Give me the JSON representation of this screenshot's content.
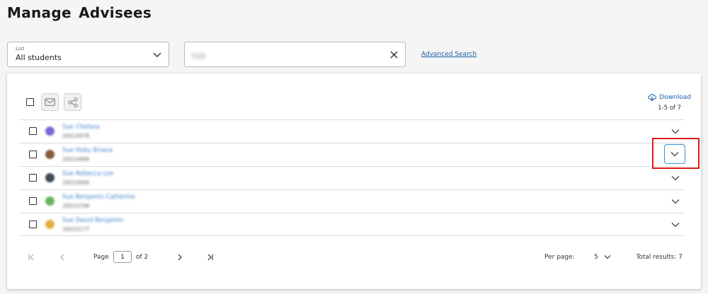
{
  "page": {
    "title": "Manage Advisees"
  },
  "filters": {
    "list_label": "List",
    "list_value": "All students",
    "search_value": "tujs",
    "advanced_search": "Advanced Search"
  },
  "toolbar": {
    "download": "Download",
    "range": "1-5 of 7"
  },
  "students": [
    {
      "name": "Sue Chelsea",
      "id": "20014978",
      "avatar_color": "#7b68d6"
    },
    {
      "name": "Sue Hoby Briana",
      "id": "20014888",
      "avatar_color": "#8a5a3c"
    },
    {
      "name": "Sue Rebecca Lee",
      "id": "20014994",
      "avatar_color": "#3d4a58"
    },
    {
      "name": "Sue Benjamin Catherine",
      "id": "20014798",
      "avatar_color": "#6cb560"
    },
    {
      "name": "Sue David Benjamin",
      "id": "20014177",
      "avatar_color": "#e3b040"
    }
  ],
  "pagination": {
    "page_label": "Page",
    "current_page": "1",
    "of_label": "of 2",
    "per_page_label": "Per page:",
    "per_page_value": "5",
    "total_results": "Total results: 7"
  },
  "colors": {
    "link": "#1a5fa8",
    "highlight": "#e01818",
    "accent": "#3a8fd0"
  }
}
